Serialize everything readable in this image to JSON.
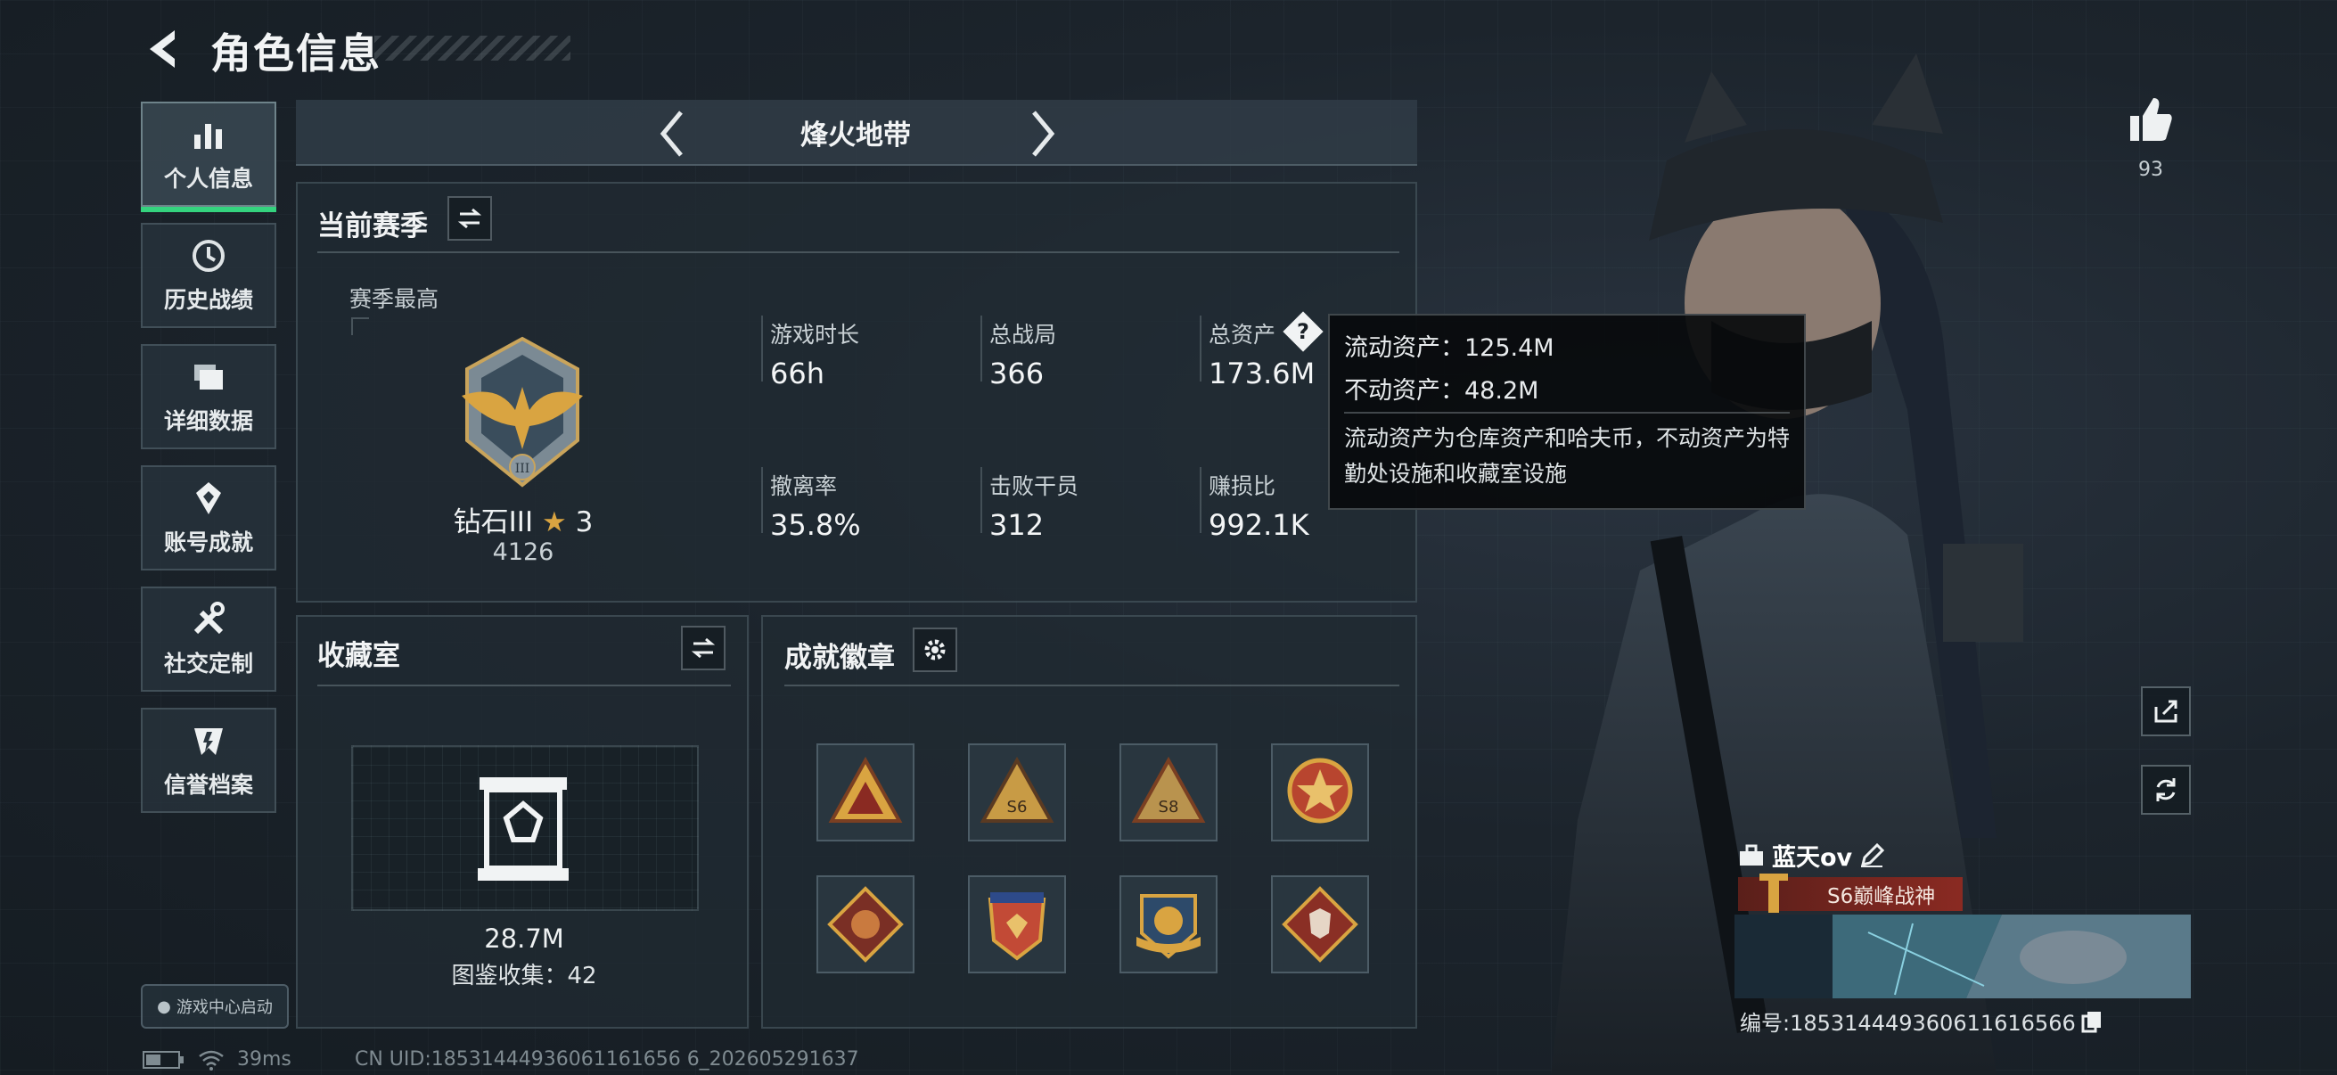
{
  "header": {
    "title": "角色信息"
  },
  "nav": {
    "items": [
      {
        "label": "个人信息",
        "icon": "bar-chart-icon",
        "active": true
      },
      {
        "label": "历史战绩",
        "icon": "history-clock-icon"
      },
      {
        "label": "详细数据",
        "icon": "folders-icon"
      },
      {
        "label": "账号成就",
        "icon": "achievement-medal-icon"
      },
      {
        "label": "社交定制",
        "icon": "tools-icon"
      },
      {
        "label": "信誉档案",
        "icon": "credit-shield-icon"
      }
    ],
    "launch_badge": "游戏中心启动"
  },
  "mode": {
    "title": "烽火地带"
  },
  "season": {
    "title": "当前赛季",
    "best_label": "赛季最高",
    "rank_name": "钻石III",
    "rank_stars": "3",
    "rank_score": "4126",
    "stats": [
      {
        "label": "游戏时长",
        "value": "66h"
      },
      {
        "label": "总战局",
        "value": "366"
      },
      {
        "label": "总资产",
        "value": "173.6M"
      },
      {
        "label": "撤离率",
        "value": "35.8%"
      },
      {
        "label": "击败干员",
        "value": "312"
      },
      {
        "label": "赚损比",
        "value": "992.1K"
      }
    ],
    "help_icon": "question-icon"
  },
  "tooltip": {
    "liquid": "流动资产：125.4M",
    "fixed": "不动资产：48.2M",
    "desc": "流动资产为仓库资产和哈夫币，不动资产为特勤处设施和收藏室设施"
  },
  "collection": {
    "title": "收藏室",
    "value": "28.7M",
    "catalog": "图鉴收集：42"
  },
  "achievements": {
    "title": "成就徽章",
    "badges": [
      "badge-triangle-gold",
      "badge-triangle-s6",
      "badge-triangle-s8",
      "badge-star-round",
      "badge-dragon-diamond",
      "badge-eagle-shield",
      "badge-wings-circle",
      "badge-wolf-diamond"
    ]
  },
  "profile": {
    "likes": "93",
    "name": "蓝天ov",
    "title": "S6巅峰战神",
    "id_text": "编号:18531444936061161656​6"
  },
  "status": {
    "ping": "39ms",
    "uid": "CN UID:18531444936061161656 6_202605291637"
  },
  "colors": {
    "accent_green": "#34d37e",
    "banner_red": "#8a2a22",
    "gold": "#d9a441"
  }
}
